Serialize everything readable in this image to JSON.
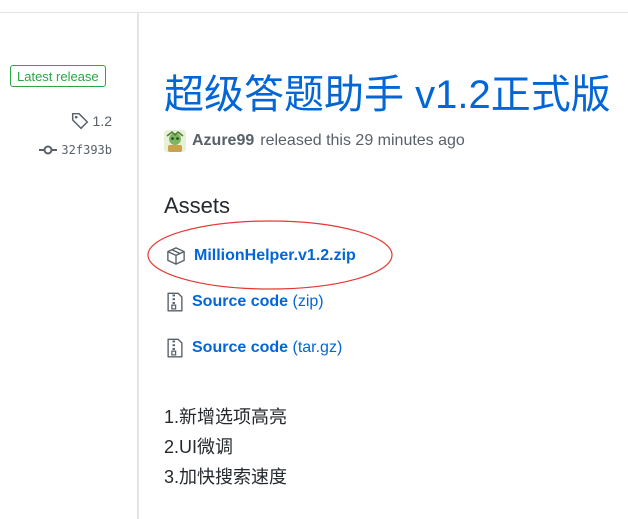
{
  "sidebar": {
    "latest_badge": "Latest release",
    "tag": "1.2",
    "commit": "32f393b",
    "tag_icon": "tag-icon",
    "commit_icon": "git-commit-icon"
  },
  "release": {
    "title": "超级答题助手 v1.2正式版",
    "author": "Azure99",
    "released_text": "released this 29 minutes ago"
  },
  "assets": {
    "heading": "Assets",
    "items": [
      {
        "icon": "package-icon",
        "name": "MillionHelper.v1.2.zip",
        "suffix": ""
      },
      {
        "icon": "file-zip-icon",
        "name": "Source code",
        "suffix": "(zip)"
      },
      {
        "icon": "file-zip-icon",
        "name": "Source code",
        "suffix": "(tar.gz)"
      }
    ]
  },
  "notes": [
    "1.新增选项高亮",
    "2.UI微调",
    "3.加快搜索速度"
  ],
  "colors": {
    "link": "#0366d6",
    "badge_green": "#28a745",
    "annotation_red": "#e53935",
    "muted": "#586069"
  }
}
